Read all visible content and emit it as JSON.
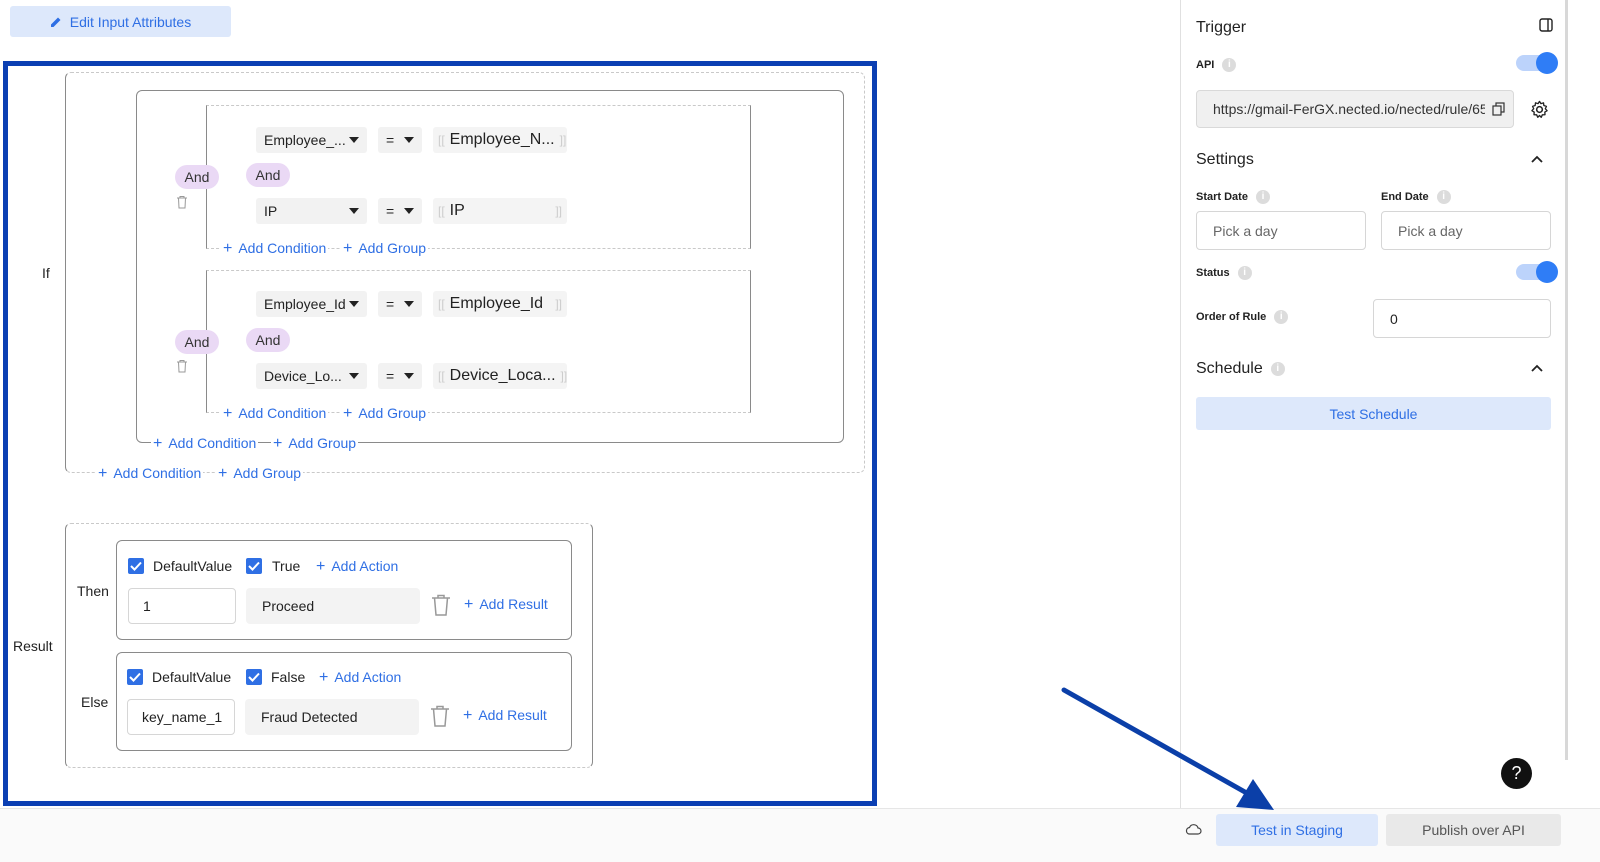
{
  "toolbar": {
    "edit_attrs_label": "Edit Input Attributes"
  },
  "rule": {
    "if_label": "If",
    "groups": [
      {
        "join": "And",
        "inner_join": "And",
        "cond1": {
          "field": "Employee_...",
          "op": "=",
          "value": "Employee_N..."
        },
        "cond2": {
          "field": "IP",
          "op": "=",
          "value": "IP"
        },
        "add_condition": "Add Condition",
        "add_group": "Add Group"
      },
      {
        "join": "And",
        "inner_join": "And",
        "cond1": {
          "field": "Employee_Id",
          "op": "=",
          "value": "Employee_Id"
        },
        "cond2": {
          "field": "Device_Lo...",
          "op": "=",
          "value": "Device_Loca..."
        },
        "add_condition": "Add Condition",
        "add_group": "Add Group"
      }
    ],
    "outer_add_condition": "Add Condition",
    "outer_add_group": "Add Group",
    "root_add_condition": "Add Condition",
    "root_add_group": "Add Group",
    "result_label": "Result",
    "then": {
      "label": "Then",
      "col1_header": "DefaultValue",
      "col2_header": "True",
      "add_action": "Add Action",
      "col1_value": "1",
      "col2_value": "Proceed",
      "add_result": "Add Result"
    },
    "else": {
      "label": "Else",
      "col1_header": "DefaultValue",
      "col2_header": "False",
      "add_action": "Add Action",
      "col1_value": "key_name_1",
      "col2_value": "Fraud Detected",
      "add_result": "Add Result"
    }
  },
  "sidebar": {
    "trigger_title": "Trigger",
    "api_label": "API",
    "api_enabled": true,
    "api_url": "https://gmail-FerGX.nected.io/nected/rule/65",
    "settings_title": "Settings",
    "start_date_label": "Start Date",
    "start_date_placeholder": "Pick a day",
    "end_date_label": "End Date",
    "end_date_placeholder": "Pick a day",
    "status_label": "Status",
    "status_enabled": true,
    "order_label": "Order of Rule",
    "order_value": "0",
    "schedule_title": "Schedule",
    "test_schedule_label": "Test Schedule"
  },
  "footer": {
    "test_staging_label": "Test in Staging",
    "publish_label": "Publish over API"
  },
  "help_label": "?",
  "colors": {
    "accent": "#2f6fe4",
    "highlight_border": "#0b3fb3",
    "pill": "#ead9f5",
    "arrow": "#0b3fa8"
  }
}
